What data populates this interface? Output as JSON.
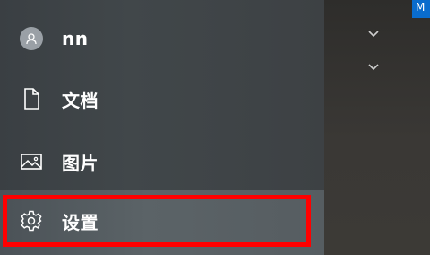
{
  "user": {
    "name": "nn"
  },
  "menu": {
    "documents_label": "文档",
    "pictures_label": "图片",
    "settings_label": "设置"
  },
  "tile": {
    "text": "M"
  },
  "icons": {
    "avatar": "person-avatar-icon",
    "documents": "document-icon",
    "pictures": "picture-icon",
    "settings": "gear-icon",
    "expand": "chevron-down-icon"
  },
  "colors": {
    "highlight_border": "#ff0000",
    "tile_accent": "#0a6ccd"
  }
}
